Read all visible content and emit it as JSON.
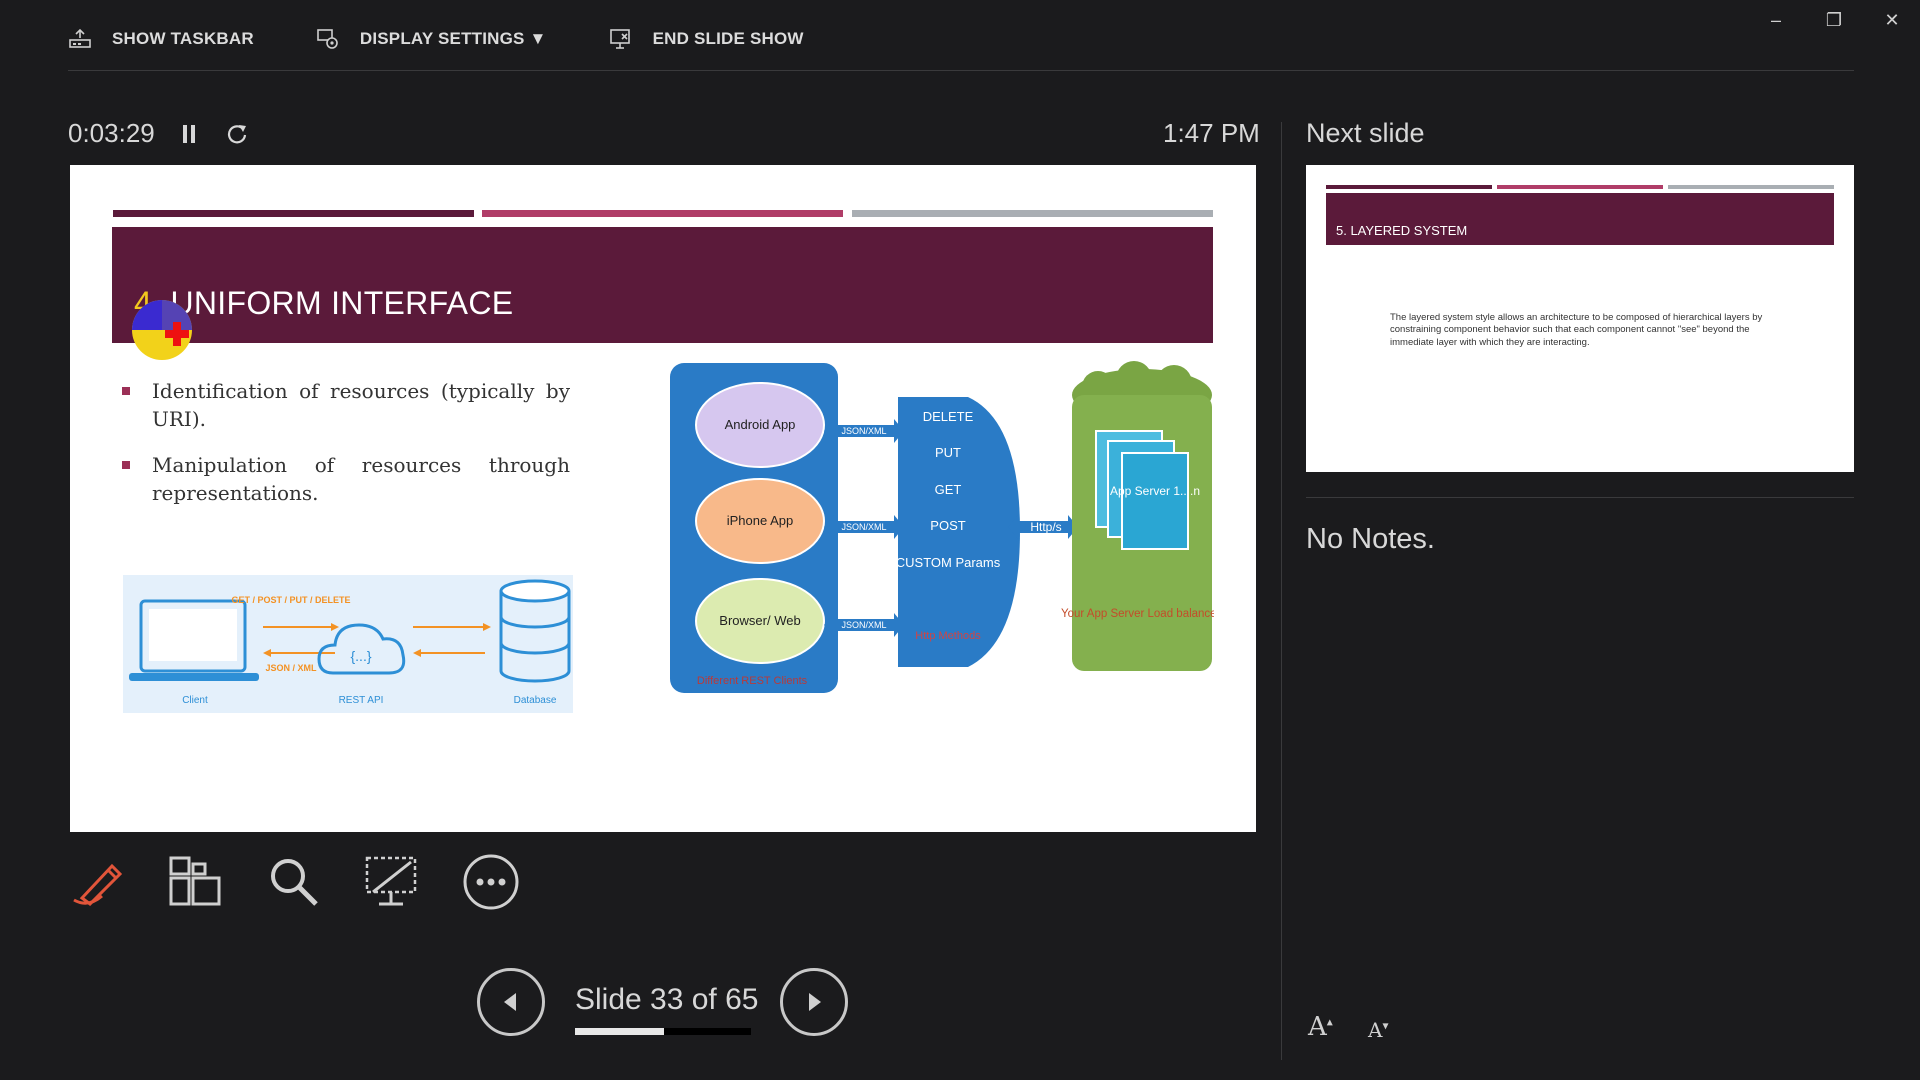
{
  "window": {
    "minimize_label": "–",
    "restore_label": "❐",
    "close_label": "✕"
  },
  "toolbar": {
    "show_taskbar": "SHOW TASKBAR",
    "display_settings": "DISPLAY SETTINGS ▼",
    "end_slide_show": "END SLIDE SHOW"
  },
  "timer": {
    "elapsed": "0:03:29",
    "clock": "1:47 PM"
  },
  "current_slide": {
    "title_number": "4.",
    "title_text": " UNIFORM INTERFACE",
    "bullets": [
      "Identification of resources (typically by URI).",
      "Manipulation of resources through representations."
    ],
    "rest_diagram": {
      "arrow_top": "GET / POST / PUT / DELETE",
      "arrow_bottom": "JSON / XML",
      "cloud_glyph": "{...}",
      "client": "Client",
      "api": "REST API",
      "database": "Database"
    },
    "clients_diagram": {
      "clients": [
        "Android App",
        "iPhone App",
        "Browser/ Web"
      ],
      "clients_caption": "Different REST Clients",
      "format_label": "JSON/XML",
      "methods": [
        "DELETE",
        "PUT",
        "GET",
        "POST",
        "CUSTOM Params"
      ],
      "methods_caption": "Http Methods",
      "protocol": "Http/s",
      "server_label": "App Server 1....n",
      "server_caption": "Your App Server Load balanced"
    }
  },
  "next_panel": {
    "label": "Next slide",
    "title": "5. LAYERED SYSTEM",
    "body": "The layered system style allows an architecture to be composed of hierarchical layers by constraining component behavior such that each component cannot \"see\" beyond the immediate layer with which they are interacting."
  },
  "notes": "No Notes.",
  "navigation": {
    "slide_text": "Slide 33 of 65",
    "current": 33,
    "total": 65
  },
  "font_buttons": {
    "increase": "A",
    "decrease": "A"
  },
  "colors": {
    "accent_maroon": "#5b1a3a",
    "accent_pink": "#b03d68",
    "accent_gray": "#a9aeb3",
    "pen_orange": "#e2553a"
  }
}
